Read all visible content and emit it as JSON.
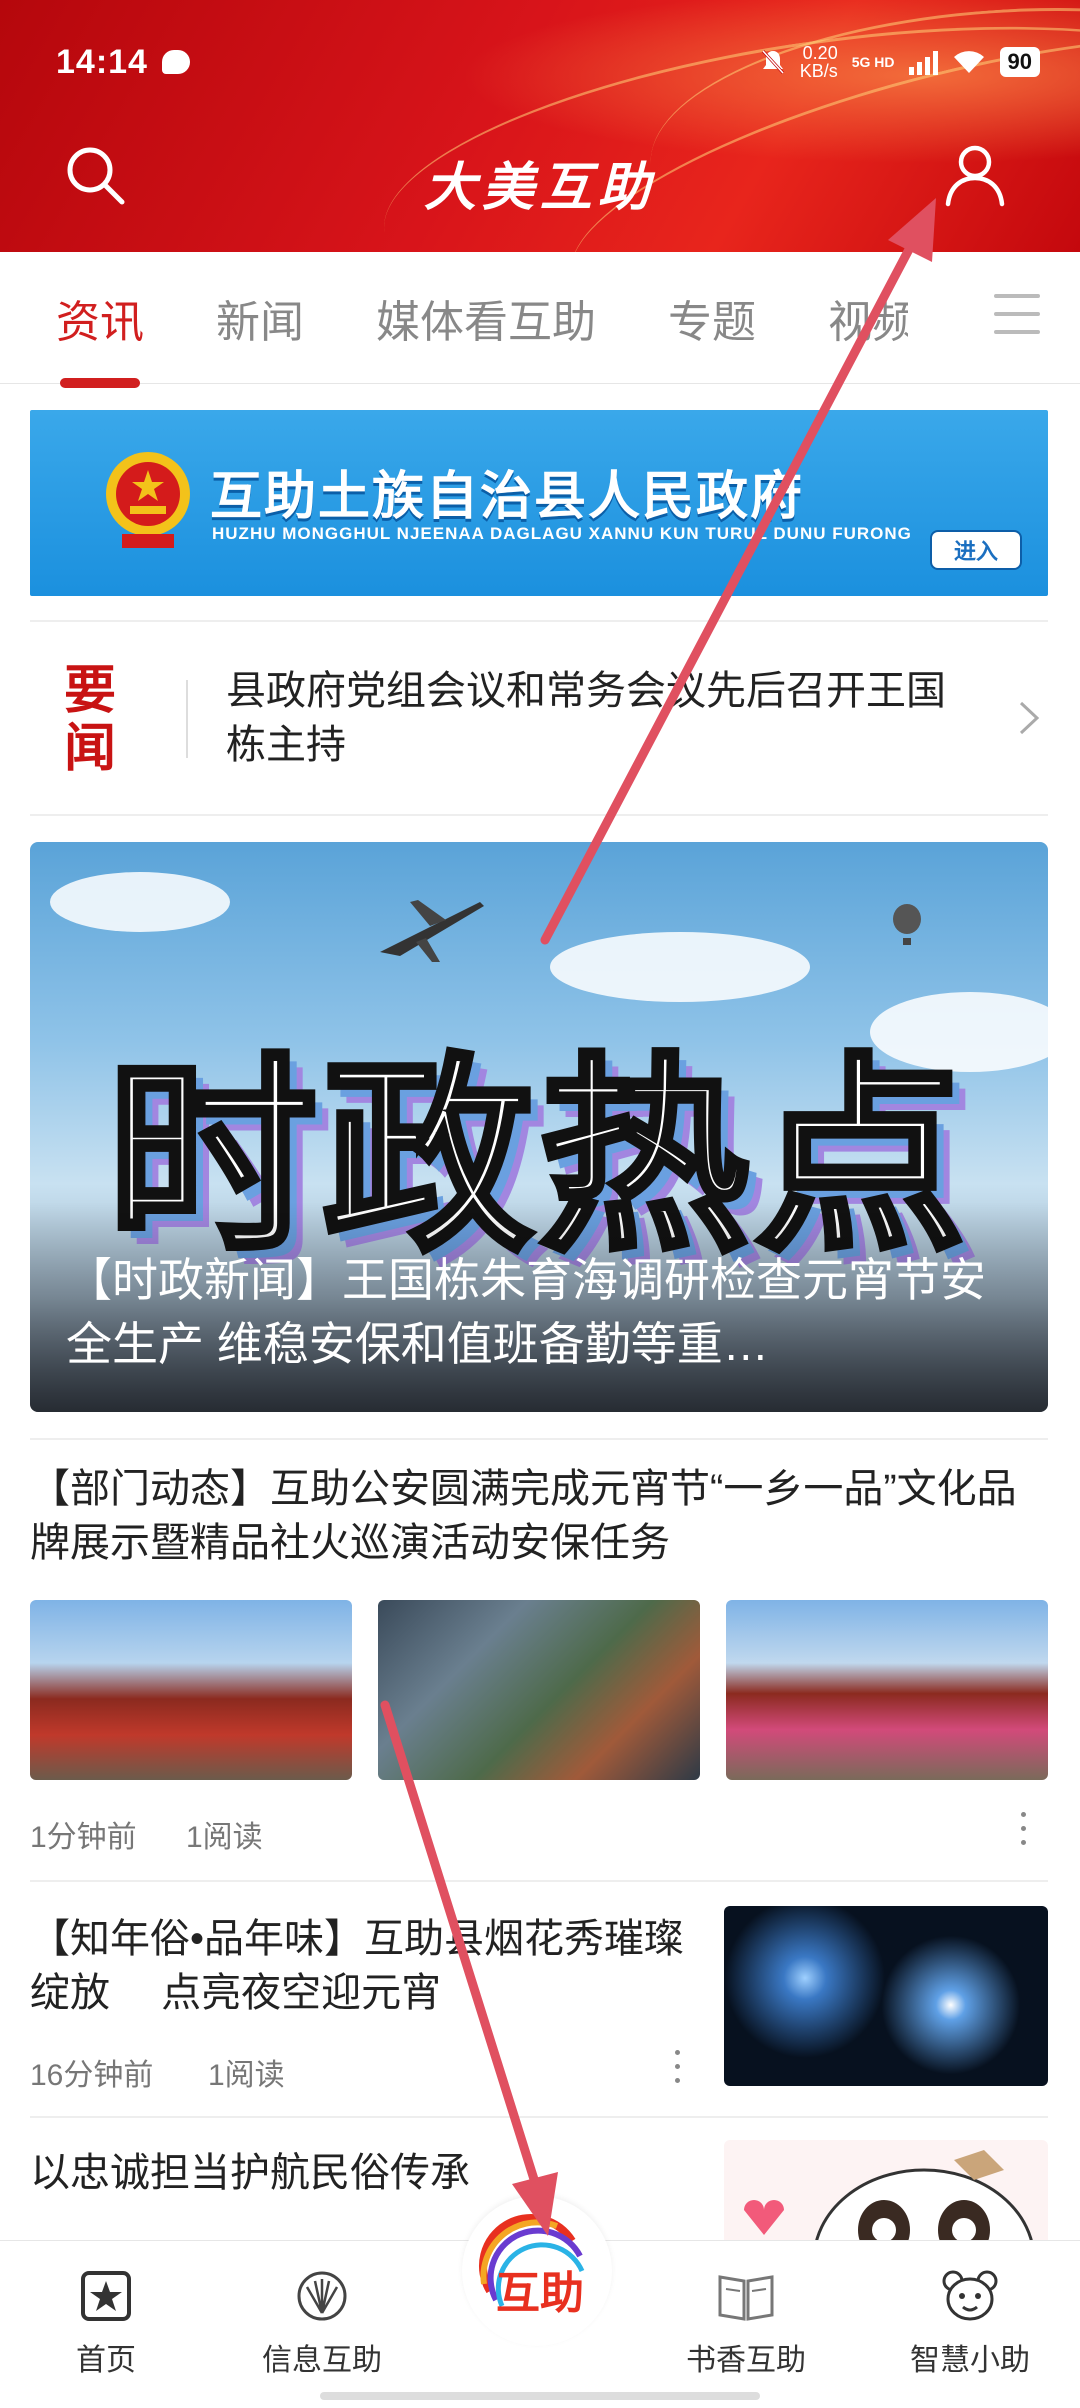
{
  "status_bar": {
    "time": "14:14",
    "speed_value": "0.20",
    "speed_unit": "KB/s",
    "network": "5G HD",
    "battery": "90"
  },
  "header": {
    "title": "大美互助"
  },
  "tabs": [
    {
      "label": "资讯",
      "active": true
    },
    {
      "label": "新闻",
      "active": false
    },
    {
      "label": "媒体看互助",
      "active": false
    },
    {
      "label": "专题",
      "active": false
    },
    {
      "label": "视频",
      "active": false
    }
  ],
  "banner": {
    "title": "互助土族自治县人民政府",
    "subtitle": "HUZHU MONGGHUL NJEENAA DAGLAGU XANNU KUN TURUL DUNU FURONG",
    "enter_label": "进入"
  },
  "headline": {
    "tag": "要闻",
    "text": "县政府党组会议和常务会议先后召开王国栋主持"
  },
  "hero": {
    "overlay_text": "时政热点",
    "caption": "【时政新闻】王国栋朱育海调研检查元宵节安全生产  维稳安保和值班备勤等重…"
  },
  "articles": [
    {
      "title": "【部门动态】互助公安圆满完成元宵节“一乡一品”文化品牌展示暨精品社火巡演活动安保任务",
      "time": "1分钟前",
      "reads": "1阅读"
    },
    {
      "title": "【知年俗•品年味】互助县烟花秀璀璨绽放　 点亮夜空迎元宵",
      "time": "16分钟前",
      "reads": "1阅读"
    },
    {
      "title": "以忠诚担当护航民俗传承"
    }
  ],
  "bottom_nav": {
    "items": [
      {
        "label": "首页",
        "icon": "star-square-icon"
      },
      {
        "label": "信息互助",
        "icon": "fan-icon"
      },
      {
        "label": "互助",
        "icon": "huzhu-logo-icon"
      },
      {
        "label": "书香互助",
        "icon": "book-icon"
      },
      {
        "label": "智慧小助",
        "icon": "bear-icon"
      }
    ]
  },
  "colors": {
    "brand_red": "#d11f1f",
    "banner_blue": "#1b90de",
    "annotation_arrow": "#e05060"
  }
}
